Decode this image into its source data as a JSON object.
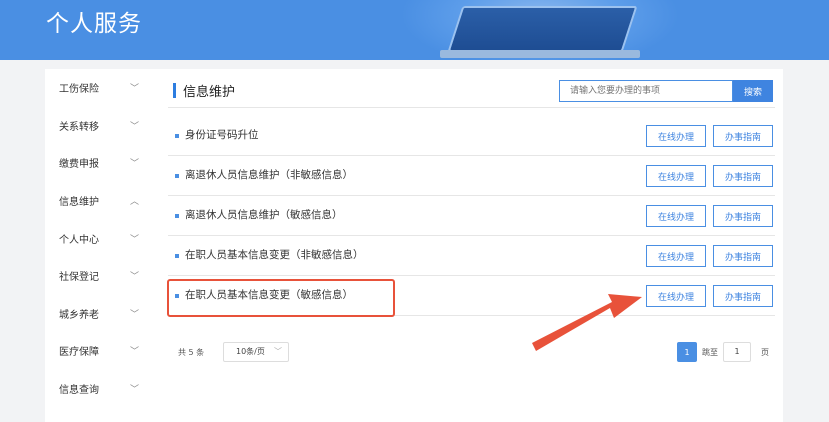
{
  "banner": {
    "title": "个人服务"
  },
  "sidebar": {
    "items": [
      {
        "label": "工伤保险",
        "chevron": "﹀"
      },
      {
        "label": "关系转移",
        "chevron": "﹀"
      },
      {
        "label": "缴费申报",
        "chevron": "﹀"
      },
      {
        "label": "信息维护",
        "chevron": "︿"
      },
      {
        "label": "个人中心",
        "chevron": "﹀"
      },
      {
        "label": "社保登记",
        "chevron": "﹀"
      },
      {
        "label": "城乡养老",
        "chevron": "﹀"
      },
      {
        "label": "医疗保障",
        "chevron": "﹀"
      },
      {
        "label": "信息查询",
        "chevron": "﹀"
      }
    ]
  },
  "main": {
    "title": "信息维护",
    "search": {
      "placeholder": "请输入您要办理的事项",
      "button": "搜索"
    },
    "rows": [
      {
        "label": "身份证号码升位",
        "online": "在线办理",
        "guide": "办事指南"
      },
      {
        "label": "离退休人员信息维护（非敏感信息）",
        "online": "在线办理",
        "guide": "办事指南"
      },
      {
        "label": "离退休人员信息维护（敏感信息）",
        "online": "在线办理",
        "guide": "办事指南"
      },
      {
        "label": "在职人员基本信息变更（非敏感信息）",
        "online": "在线办理",
        "guide": "办事指南"
      },
      {
        "label": "在职人员基本信息变更（敏感信息）",
        "online": "在线办理",
        "guide": "办事指南"
      }
    ],
    "pager": {
      "total": "共 5 条",
      "page_size": "10条/页",
      "page_size_chevron": "﹀",
      "current_page": "1",
      "goto_label": "跳至",
      "goto_value": "1",
      "page_unit": "页"
    }
  },
  "annotation": {
    "highlight_color": "#e8523a",
    "arrow_color": "#e8523a"
  }
}
